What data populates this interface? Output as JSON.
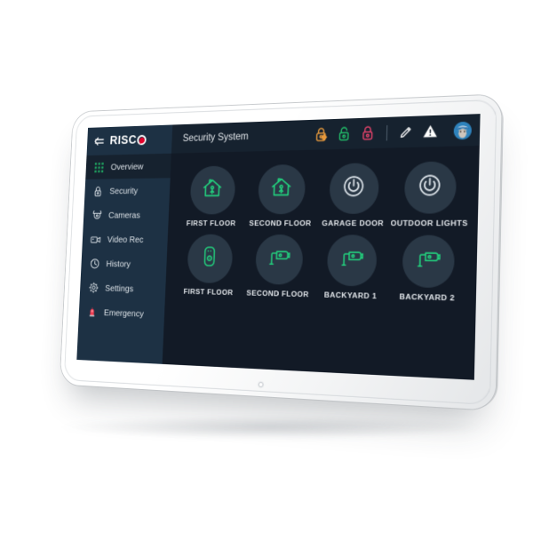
{
  "device": {
    "kind": "wall-mounted-touchscreen-keypad",
    "body_color": "#f4f5f6",
    "screen_bg": "#121a26",
    "sidebar_bg": "#1d3144",
    "accent_green": "#22d07d",
    "accent_red": "#e4002b",
    "led_indicator": "on"
  },
  "topbar": {
    "back_icon": "back-arrow-icon",
    "brand": "RISC",
    "brand_o": "O",
    "title": "Security System",
    "actions": [
      {
        "name": "partial-arm-button",
        "icon": "lock-partial-icon",
        "color": "#e89a3c",
        "state": "partial-arm"
      },
      {
        "name": "disarm-button",
        "icon": "lock-open-icon",
        "color": "#22c06a",
        "state": "disarm"
      },
      {
        "name": "arm-button",
        "icon": "lock-closed-icon",
        "color": "#e8436b",
        "state": "full-arm"
      },
      {
        "name": "edit-button",
        "icon": "pencil-icon",
        "color": "#ffffff",
        "state": "edit"
      },
      {
        "name": "alerts-button",
        "icon": "warning-triangle-icon",
        "color": "#ffffff",
        "state": "alerts"
      }
    ],
    "avatar": {
      "name": "user-avatar",
      "alt": "User profile"
    }
  },
  "sidebar": {
    "items": [
      {
        "label": "Overview",
        "icon": "grid-icon",
        "active": true
      },
      {
        "label": "Security",
        "icon": "lock-icon",
        "active": false
      },
      {
        "label": "Cameras",
        "icon": "dome-camera-icon",
        "active": false
      },
      {
        "label": "Video Rec",
        "icon": "video-camera-icon",
        "active": false
      },
      {
        "label": "History",
        "icon": "clock-icon",
        "active": false
      },
      {
        "label": "Settings",
        "icon": "gear-icon",
        "active": false
      },
      {
        "label": "Emergency",
        "icon": "siren-icon",
        "active": false
      }
    ]
  },
  "main": {
    "rows": [
      {
        "tiles": [
          {
            "label": "FIRST FLOOR",
            "icon": "house-occupied-icon",
            "color": "#22d07d"
          },
          {
            "label": "SECOND FLOOR",
            "icon": "house-occupied-icon",
            "color": "#22d07d"
          },
          {
            "label": "GARAGE DOOR",
            "icon": "power-icon",
            "color": "#dfe6ec"
          },
          {
            "label": "OUTDOOR LIGHTS",
            "icon": "power-icon",
            "color": "#dfe6ec"
          }
        ]
      },
      {
        "tiles": [
          {
            "label": "FIRST FLOOR",
            "icon": "doorbell-icon",
            "color": "#22d07d"
          },
          {
            "label": "SECOND FLOOR",
            "icon": "cctv-camera-icon",
            "color": "#22d07d"
          },
          {
            "label": "BACKYARD 1",
            "icon": "cctv-camera-icon",
            "color": "#22d07d"
          },
          {
            "label": "BACKYARD 2",
            "icon": "cctv-camera-icon",
            "color": "#22d07d"
          }
        ]
      }
    ]
  }
}
